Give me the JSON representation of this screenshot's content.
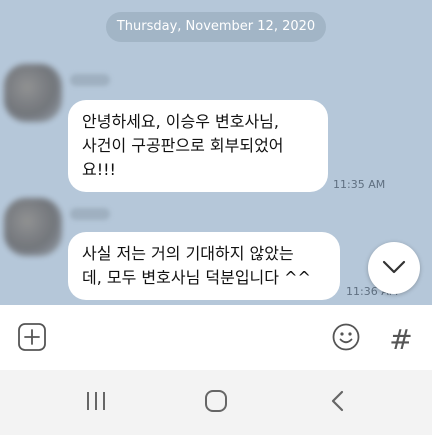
{
  "chat": {
    "date_label": "Thursday, November 12, 2020",
    "messages": [
      {
        "text": "안녕하세요, 이승우 변호사님,\n사건이 구공판으로 회부되었어\n요!!!",
        "time": "11:35 AM"
      },
      {
        "text": "사실 저는 거의 기대하지 않았는\n데, 모두 변호사님 덕분입니다 ^^",
        "time": "11:36 AM"
      }
    ]
  },
  "input_bar": {
    "add_icon": "plus-square-icon",
    "emoji_icon": "smiley-icon",
    "hashtag_icon": "hashtag-icon",
    "hashtag_glyph": "#"
  },
  "navbar": {
    "recents_icon": "recents-icon",
    "home_icon": "home-icon",
    "back_icon": "back-icon"
  },
  "colors": {
    "chat_background": "#b5c7d9",
    "bubble": "#ffffff",
    "date_pill": "#a2b5c6"
  }
}
